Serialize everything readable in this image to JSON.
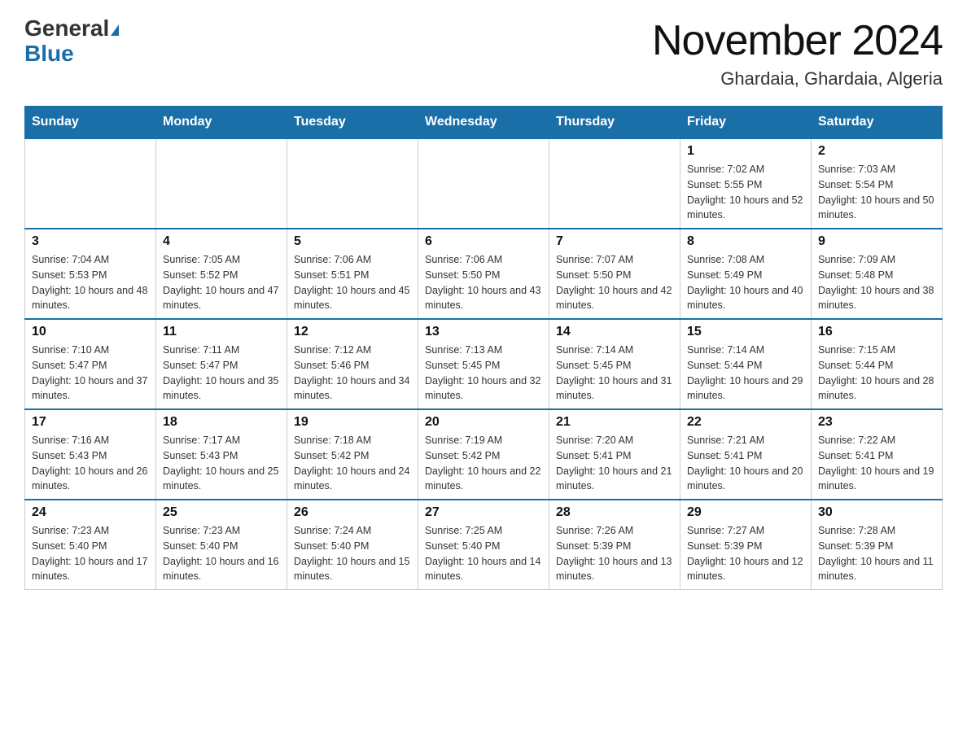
{
  "header": {
    "logo_general": "General",
    "logo_blue": "Blue",
    "month_title": "November 2024",
    "location": "Ghardaia, Ghardaia, Algeria"
  },
  "days_of_week": [
    "Sunday",
    "Monday",
    "Tuesday",
    "Wednesday",
    "Thursday",
    "Friday",
    "Saturday"
  ],
  "weeks": [
    [
      {
        "day": "",
        "info": ""
      },
      {
        "day": "",
        "info": ""
      },
      {
        "day": "",
        "info": ""
      },
      {
        "day": "",
        "info": ""
      },
      {
        "day": "",
        "info": ""
      },
      {
        "day": "1",
        "info": "Sunrise: 7:02 AM\nSunset: 5:55 PM\nDaylight: 10 hours and 52 minutes."
      },
      {
        "day": "2",
        "info": "Sunrise: 7:03 AM\nSunset: 5:54 PM\nDaylight: 10 hours and 50 minutes."
      }
    ],
    [
      {
        "day": "3",
        "info": "Sunrise: 7:04 AM\nSunset: 5:53 PM\nDaylight: 10 hours and 48 minutes."
      },
      {
        "day": "4",
        "info": "Sunrise: 7:05 AM\nSunset: 5:52 PM\nDaylight: 10 hours and 47 minutes."
      },
      {
        "day": "5",
        "info": "Sunrise: 7:06 AM\nSunset: 5:51 PM\nDaylight: 10 hours and 45 minutes."
      },
      {
        "day": "6",
        "info": "Sunrise: 7:06 AM\nSunset: 5:50 PM\nDaylight: 10 hours and 43 minutes."
      },
      {
        "day": "7",
        "info": "Sunrise: 7:07 AM\nSunset: 5:50 PM\nDaylight: 10 hours and 42 minutes."
      },
      {
        "day": "8",
        "info": "Sunrise: 7:08 AM\nSunset: 5:49 PM\nDaylight: 10 hours and 40 minutes."
      },
      {
        "day": "9",
        "info": "Sunrise: 7:09 AM\nSunset: 5:48 PM\nDaylight: 10 hours and 38 minutes."
      }
    ],
    [
      {
        "day": "10",
        "info": "Sunrise: 7:10 AM\nSunset: 5:47 PM\nDaylight: 10 hours and 37 minutes."
      },
      {
        "day": "11",
        "info": "Sunrise: 7:11 AM\nSunset: 5:47 PM\nDaylight: 10 hours and 35 minutes."
      },
      {
        "day": "12",
        "info": "Sunrise: 7:12 AM\nSunset: 5:46 PM\nDaylight: 10 hours and 34 minutes."
      },
      {
        "day": "13",
        "info": "Sunrise: 7:13 AM\nSunset: 5:45 PM\nDaylight: 10 hours and 32 minutes."
      },
      {
        "day": "14",
        "info": "Sunrise: 7:14 AM\nSunset: 5:45 PM\nDaylight: 10 hours and 31 minutes."
      },
      {
        "day": "15",
        "info": "Sunrise: 7:14 AM\nSunset: 5:44 PM\nDaylight: 10 hours and 29 minutes."
      },
      {
        "day": "16",
        "info": "Sunrise: 7:15 AM\nSunset: 5:44 PM\nDaylight: 10 hours and 28 minutes."
      }
    ],
    [
      {
        "day": "17",
        "info": "Sunrise: 7:16 AM\nSunset: 5:43 PM\nDaylight: 10 hours and 26 minutes."
      },
      {
        "day": "18",
        "info": "Sunrise: 7:17 AM\nSunset: 5:43 PM\nDaylight: 10 hours and 25 minutes."
      },
      {
        "day": "19",
        "info": "Sunrise: 7:18 AM\nSunset: 5:42 PM\nDaylight: 10 hours and 24 minutes."
      },
      {
        "day": "20",
        "info": "Sunrise: 7:19 AM\nSunset: 5:42 PM\nDaylight: 10 hours and 22 minutes."
      },
      {
        "day": "21",
        "info": "Sunrise: 7:20 AM\nSunset: 5:41 PM\nDaylight: 10 hours and 21 minutes."
      },
      {
        "day": "22",
        "info": "Sunrise: 7:21 AM\nSunset: 5:41 PM\nDaylight: 10 hours and 20 minutes."
      },
      {
        "day": "23",
        "info": "Sunrise: 7:22 AM\nSunset: 5:41 PM\nDaylight: 10 hours and 19 minutes."
      }
    ],
    [
      {
        "day": "24",
        "info": "Sunrise: 7:23 AM\nSunset: 5:40 PM\nDaylight: 10 hours and 17 minutes."
      },
      {
        "day": "25",
        "info": "Sunrise: 7:23 AM\nSunset: 5:40 PM\nDaylight: 10 hours and 16 minutes."
      },
      {
        "day": "26",
        "info": "Sunrise: 7:24 AM\nSunset: 5:40 PM\nDaylight: 10 hours and 15 minutes."
      },
      {
        "day": "27",
        "info": "Sunrise: 7:25 AM\nSunset: 5:40 PM\nDaylight: 10 hours and 14 minutes."
      },
      {
        "day": "28",
        "info": "Sunrise: 7:26 AM\nSunset: 5:39 PM\nDaylight: 10 hours and 13 minutes."
      },
      {
        "day": "29",
        "info": "Sunrise: 7:27 AM\nSunset: 5:39 PM\nDaylight: 10 hours and 12 minutes."
      },
      {
        "day": "30",
        "info": "Sunrise: 7:28 AM\nSunset: 5:39 PM\nDaylight: 10 hours and 11 minutes."
      }
    ]
  ]
}
